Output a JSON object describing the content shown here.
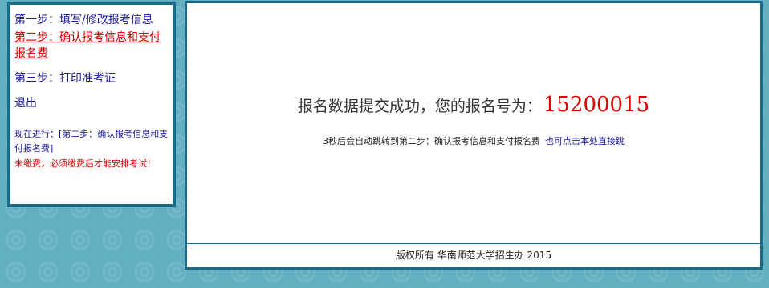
{
  "sidebar": {
    "steps": [
      {
        "label": "第一步：填写/修改报考信息"
      },
      {
        "label": "第二步：确认报考信息和支付报名费"
      },
      {
        "label": "第三步：打印准考证"
      },
      {
        "label": "退出"
      }
    ],
    "status_text": "现在进行：[第二步：确认报考信息和支付报名费]",
    "unpaid_warning": "未缴费，必须缴费后才能安排考试！"
  },
  "main": {
    "success_message": "报名数据提交成功，您的报名号为：",
    "registration_number": "15200015",
    "redirect_text": "3秒后会自动跳转到第二步：确认报考信息和支付报名费",
    "redirect_link": "也可点击本处直接跳",
    "footer": "版权所有 华南师范大学招生办 2015"
  },
  "colors": {
    "page_background": "#63afc2",
    "border": "#1a6b8a",
    "link": "#1a1a99",
    "highlight": "#cc0000"
  }
}
